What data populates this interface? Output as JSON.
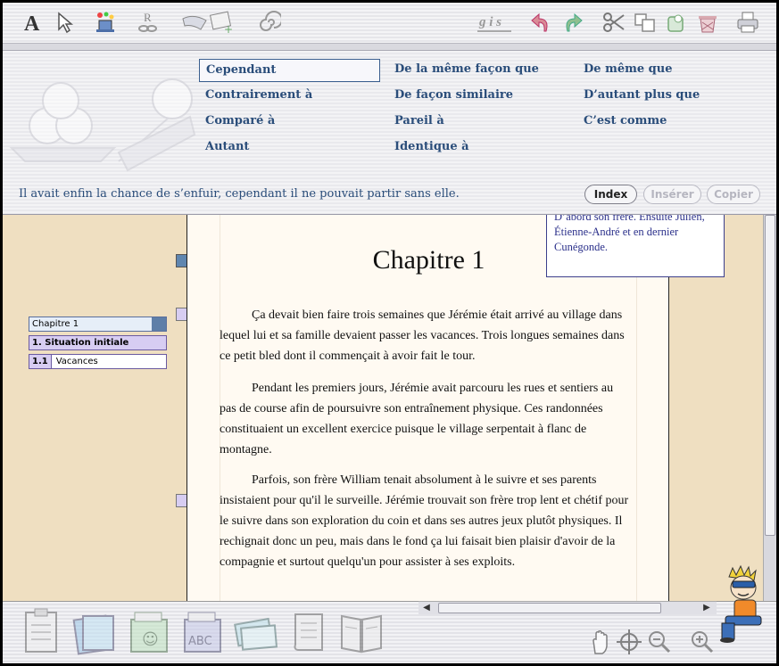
{
  "toolbar": {
    "left_icons": [
      "font-icon",
      "pointer-icon",
      "magic-hat-icon",
      "relation-icon",
      "shapes-icon",
      "spiral-icon"
    ],
    "format_label": "g i s",
    "right_icons": [
      "undo-icon",
      "redo-icon",
      "cut-icon",
      "copy-icon",
      "paste-icon",
      "trash-icon",
      "print-icon"
    ]
  },
  "connectors": {
    "column1": [
      "Cependant",
      "Contrairement à",
      "Comparé à",
      "Autant"
    ],
    "column2": [
      "De la même façon que",
      "De façon similaire",
      "Pareil à",
      "Identique à"
    ],
    "column3": [
      "De même que",
      "D’autant plus que",
      "C’est comme"
    ],
    "selected": "Cependant",
    "example": "Il avait enfin la chance de s’enfuir, cependant il ne pouvait partir sans elle.",
    "buttons": {
      "index": "Index",
      "insert": "Insérer",
      "copy": "Copier"
    }
  },
  "outline": {
    "chapter": "Chapitre 1",
    "section": "1. Situation initiale",
    "sub_number": "1.1",
    "sub_label": "Vacances"
  },
  "document": {
    "chapter_title": "Chapitre 1",
    "note": "D’abord son frère. Ensuite Julien, Étienne-André et en dernier Cunégonde.",
    "paragraphs": [
      "Ça devait bien faire trois semaines que Jérémie était arrivé au village dans lequel lui et sa famille devaient passer les vacances. Trois longues semaines dans ce petit bled dont il commençait à avoir fait le tour.",
      "Pendant les premiers jours, Jérémie avait parcouru les rues et sentiers au pas de course afin de poursuivre son entraînement physique. Ces randonnées constituaient un excellent exercice puisque le village serpentait à flanc de montagne.",
      "Parfois, son frère William tenait absolument à le suivre et ses parents insistaient pour qu'il le surveille. Jérémie trouvait son frère trop lent et chétif pour le suivre dans son exploration du coin et dans ses autres jeux plutôt physiques. Il rechignait donc un peu, mais dans le fond ça lui faisait bien plaisir d'avoir de la compagnie et surtout quelqu'un pour assister à ses exploits."
    ]
  },
  "bottombar": {
    "left_icons": [
      "document-icon",
      "folders-icon",
      "character-cards-icon",
      "dictionary-icon",
      "notes-icon",
      "scroll-icon",
      "book-icon"
    ],
    "right_icons": [
      "hand-icon",
      "target-icon",
      "zoom-out-icon",
      "zoom-in-icon"
    ]
  },
  "colors": {
    "connector_text": "#2a4d7a",
    "page_bg": "#fffaf2",
    "desk_bg": "#efdfc1"
  }
}
